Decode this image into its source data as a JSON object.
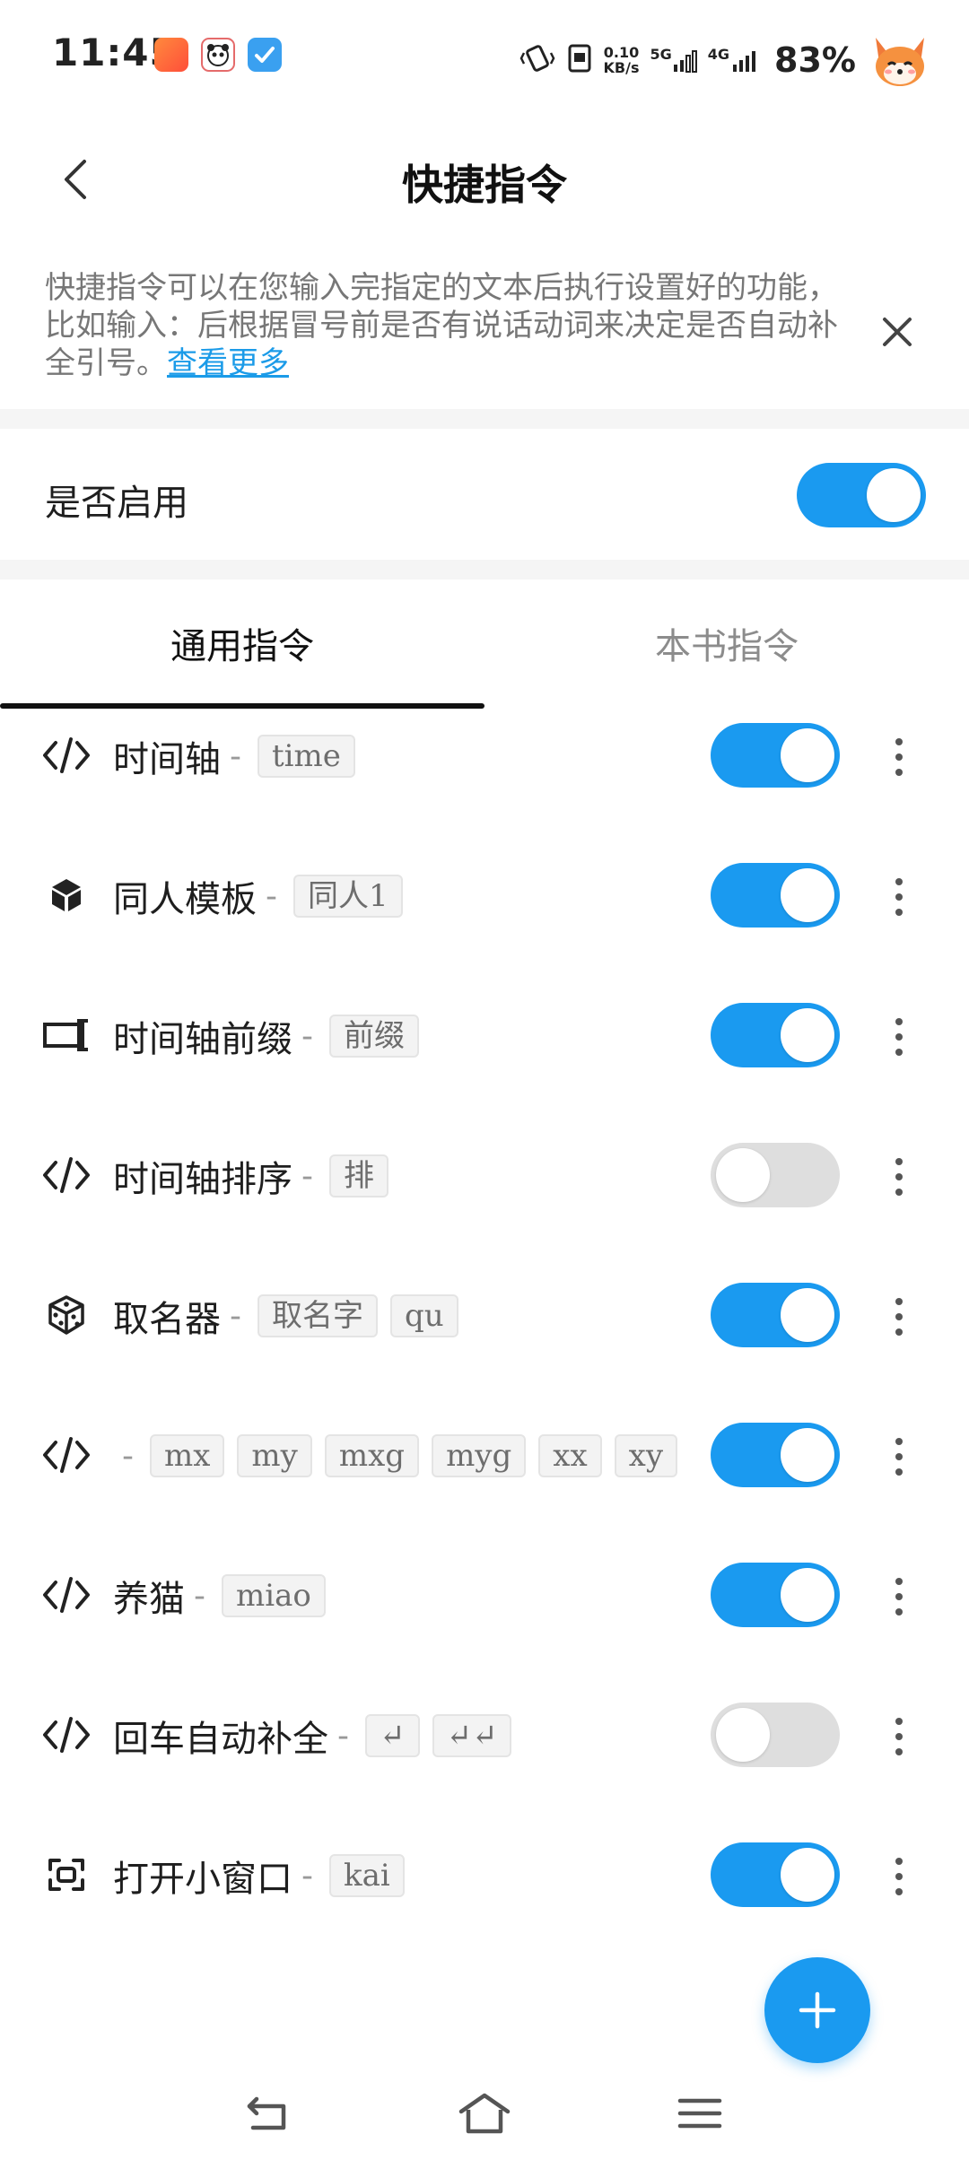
{
  "status_bar": {
    "time": "11:45",
    "net_speed_value": "0.10",
    "net_speed_unit": "KB/s",
    "signal_5g": "5G",
    "signal_4g": "4G",
    "battery": "83%"
  },
  "header": {
    "title": "快捷指令"
  },
  "info": {
    "text": "快捷指令可以在您输入完指定的文本后执行设置好的功能，比如输入：后根据冒号前是否有说话动词来决定是否自动补全引号。",
    "link": "查看更多"
  },
  "enable": {
    "label": "是否启用",
    "enabled": true
  },
  "tabs": [
    {
      "label": "通用指令",
      "active": true
    },
    {
      "label": "本书指令",
      "active": false
    }
  ],
  "commands": [
    {
      "icon": "code-icon",
      "name": "时间轴",
      "triggers": [
        "time"
      ],
      "enabled": true
    },
    {
      "icon": "cube-icon",
      "name": "同人模板",
      "triggers": [
        "同人1"
      ],
      "enabled": true
    },
    {
      "icon": "prefix-icon",
      "name": "时间轴前缀",
      "triggers": [
        "前缀"
      ],
      "enabled": true
    },
    {
      "icon": "code-icon",
      "name": "时间轴排序",
      "triggers": [
        "排"
      ],
      "enabled": false
    },
    {
      "icon": "dice-icon",
      "name": "取名器",
      "triggers": [
        "取名字",
        "qu"
      ],
      "enabled": true
    },
    {
      "icon": "code-icon",
      "name": "",
      "triggers": [
        "mx",
        "my",
        "mxg",
        "myg",
        "xx",
        "xy"
      ],
      "enabled": true
    },
    {
      "icon": "code-icon",
      "name": "养猫",
      "triggers": [
        "miao"
      ],
      "enabled": true
    },
    {
      "icon": "code-icon",
      "name": "回车自动补全",
      "triggers": [
        "↵",
        "↵↵"
      ],
      "enabled": false
    },
    {
      "icon": "window-icon",
      "name": "打开小窗口",
      "triggers": [
        "kai"
      ],
      "enabled": true
    }
  ],
  "colors": {
    "accent": "#1a9af0",
    "switch_off": "#dedede",
    "link": "#1b9be8"
  }
}
